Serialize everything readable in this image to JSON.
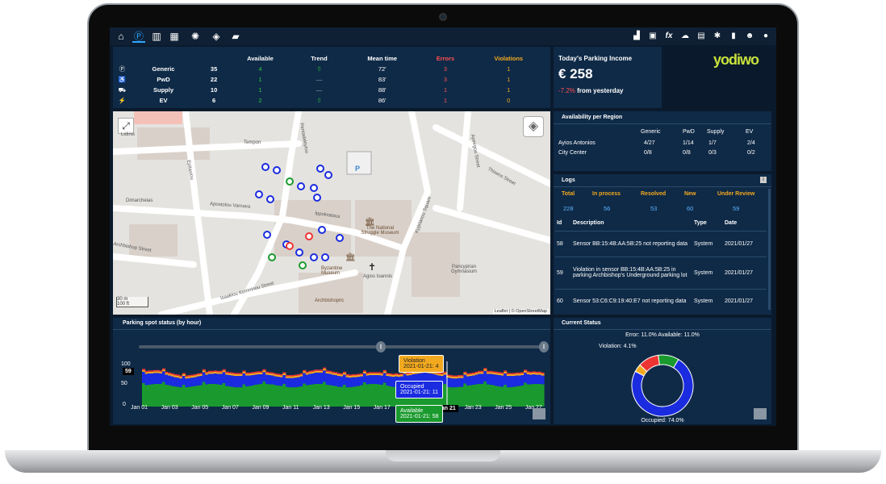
{
  "nav": {
    "left_icons": [
      "home-icon",
      "parking-icon",
      "trash-icon",
      "building-icon",
      "lamp-icon",
      "satellite-icon",
      "camera-icon"
    ],
    "right_icons": [
      "chart-icon",
      "image-icon",
      "function-icon",
      "cloud-icon",
      "document-icon",
      "bell-icon",
      "bookmark-icon",
      "user-add-icon",
      "user-icon"
    ]
  },
  "summary": {
    "headers": [
      "Available",
      "Trend",
      "Mean time",
      "Errors",
      "Violations"
    ],
    "rows": [
      {
        "type": "Generic",
        "total": "35",
        "available": "4",
        "trend": "up",
        "mean": "72'",
        "errors": "3",
        "violations": "1"
      },
      {
        "type": "PwD",
        "total": "22",
        "available": "1",
        "trend": "flat",
        "mean": "83'",
        "errors": "3",
        "violations": "1"
      },
      {
        "type": "Supply",
        "total": "10",
        "available": "1",
        "trend": "flat",
        "mean": "88'",
        "errors": "1",
        "violations": "1"
      },
      {
        "type": "EV",
        "total": "6",
        "available": "2",
        "trend": "up",
        "mean": "86'",
        "errors": "1",
        "violations": "0"
      }
    ]
  },
  "income": {
    "title": "Today's Parking Income",
    "amount": "€ 258",
    "change": "-7.2%",
    "change_suffix": "from yesterday"
  },
  "brand": {
    "logo": "yodiwo"
  },
  "availability": {
    "title": "Availability per Region",
    "columns": [
      "Generic",
      "PwD",
      "Supply",
      "EV"
    ],
    "rows": [
      {
        "region": "Ayios Antonios",
        "values": [
          "4/27",
          "1/14",
          "1/7",
          "2/4"
        ]
      },
      {
        "region": "City Center",
        "values": [
          "0/8",
          "0/8",
          "0/3",
          "0/2"
        ]
      }
    ]
  },
  "logs": {
    "title": "Logs",
    "stats_labels": [
      "Total",
      "In process",
      "Resolved",
      "New",
      "Under Review"
    ],
    "stats_values": [
      "228",
      "56",
      "53",
      "60",
      "59"
    ],
    "columns": [
      "Id",
      "Description",
      "Type",
      "Date"
    ],
    "rows": [
      {
        "id": "58",
        "description": "Sensor BB:15:4B:AA:5B:25 not reporting data",
        "type": "System",
        "date": "2021/01/27"
      },
      {
        "id": "59",
        "description": "Violation in sensor BB:15:4B:AA:5B:25 in parking Archbishop's Underground parking lot",
        "type": "System",
        "date": "2021/01/27"
      },
      {
        "id": "60",
        "description": "Sensor 53:C6:C9:19:40:E7 not reporting data",
        "type": "System",
        "date": "2021/01/27"
      }
    ]
  },
  "map": {
    "streets": [
      "Lidinis",
      "Tempon",
      "Pentadaktylou",
      "Epitaxiou",
      "Dimarcheias",
      "Apostolou Varnava",
      "Ippokratous",
      "Thiseos Street",
      "Kyprianou Square",
      "Archbishop Street",
      "Isaakiou Komninou Street",
      "Agios Ioannis",
      "Byzantine Museum",
      "Archbishopric",
      "The National Struggle Museum",
      "Pancyprian Gymnasium",
      "Apeirgou Street"
    ],
    "scale_m": "30 m",
    "scale_ft": "100 ft",
    "attribution": "Leaflet | © OpenStreetMap"
  },
  "status_chart": {
    "title": "Parking spot status (by hour)",
    "y_ticks": [
      "100",
      "50",
      "0"
    ],
    "y_marker": "59",
    "x_ticks": [
      "Jan 01",
      "Jan 03",
      "Jan 05",
      "Jan 07",
      "Jan 09",
      "Jan 11",
      "Jan 13",
      "Jan 15",
      "Jan 17",
      "Jan 19",
      "Jan 21",
      "Jan 23",
      "Jan 25",
      "Jan 27"
    ],
    "x_highlight": "Jan 21",
    "tooltips": [
      {
        "label": "Violation",
        "date": "2021-01-21: 4",
        "color": "#f2a91f"
      },
      {
        "label": "Occupied",
        "date": "2021-01-21: 11",
        "color": "#1a2be0"
      },
      {
        "label": "Available",
        "date": "2021-01-21: 58",
        "color": "#1a9a2e"
      }
    ]
  },
  "chart_data": {
    "type": "area",
    "title": "Parking spot status (by hour)",
    "x": [
      "Jan 01",
      "Jan 03",
      "Jan 05",
      "Jan 07",
      "Jan 09",
      "Jan 11",
      "Jan 13",
      "Jan 15",
      "Jan 17",
      "Jan 19",
      "Jan 21",
      "Jan 23",
      "Jan 25",
      "Jan 27"
    ],
    "ylim": [
      0,
      100
    ],
    "series": [
      {
        "name": "Available",
        "color": "#1a9a2e"
      },
      {
        "name": "Occupied",
        "color": "#1a2be0"
      },
      {
        "name": "Violation",
        "color": "#f2a91f"
      }
    ],
    "highlight": {
      "x": "Jan 21",
      "Available": 58,
      "Occupied": 11,
      "Violation": 4
    }
  },
  "donut": {
    "title": "Current Status",
    "top_label": "Error: 11.0% Available: 11.0%",
    "left_label": "Violation: 4.1%",
    "bottom_label": "Occupied: 74.0%",
    "segments": [
      {
        "name": "Occupied",
        "value": 74.0,
        "color": "#1a2be0"
      },
      {
        "name": "Violation",
        "value": 4.1,
        "color": "#f2a91f"
      },
      {
        "name": "Error",
        "value": 11.0,
        "color": "#e33"
      },
      {
        "name": "Available",
        "value": 11.0,
        "color": "#1a9a2e"
      }
    ]
  }
}
